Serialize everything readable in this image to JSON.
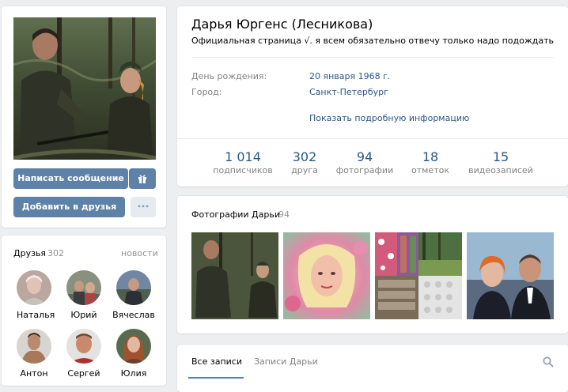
{
  "profile": {
    "name": "Дарья Юргенс (Лесникова)",
    "status": "Официальная страница √. я всем обязательно отвечу только надо подождать",
    "info": [
      {
        "label": "День рождения:",
        "value": "20 января 1968 г."
      },
      {
        "label": "Город:",
        "value": "Санкт-Петербург"
      }
    ],
    "more_link": "Показать подробную информацию",
    "counters": [
      {
        "value": "1 014",
        "label": "подписчиков"
      },
      {
        "value": "302",
        "label": "друга"
      },
      {
        "value": "94",
        "label": "фотографии"
      },
      {
        "value": "18",
        "label": "отметок"
      },
      {
        "value": "15",
        "label": "видеозаписей"
      }
    ]
  },
  "actions": {
    "message_label": "Написать сообщение",
    "add_friend_label": "Добавить в друзья",
    "more_dots": "•••"
  },
  "friends": {
    "title": "Друзья",
    "count": "302",
    "news_link": "новости",
    "items": [
      {
        "name": "Наталья"
      },
      {
        "name": "Юрий"
      },
      {
        "name": "Вячеслав"
      },
      {
        "name": "Антон"
      },
      {
        "name": "Сергей"
      },
      {
        "name": "Юлия"
      }
    ]
  },
  "photos": {
    "title": "Фотографии Дарьи",
    "count": "94"
  },
  "wall": {
    "tabs": [
      {
        "label": "Все записи"
      },
      {
        "label": "Записи Дарьи"
      }
    ]
  },
  "icons": {
    "gift": "gift-icon",
    "search": "search-icon"
  },
  "colors": {
    "button_primary": "#5e81a8",
    "link": "#2a5885",
    "muted": "#828282",
    "page_bg": "#edeef0"
  }
}
